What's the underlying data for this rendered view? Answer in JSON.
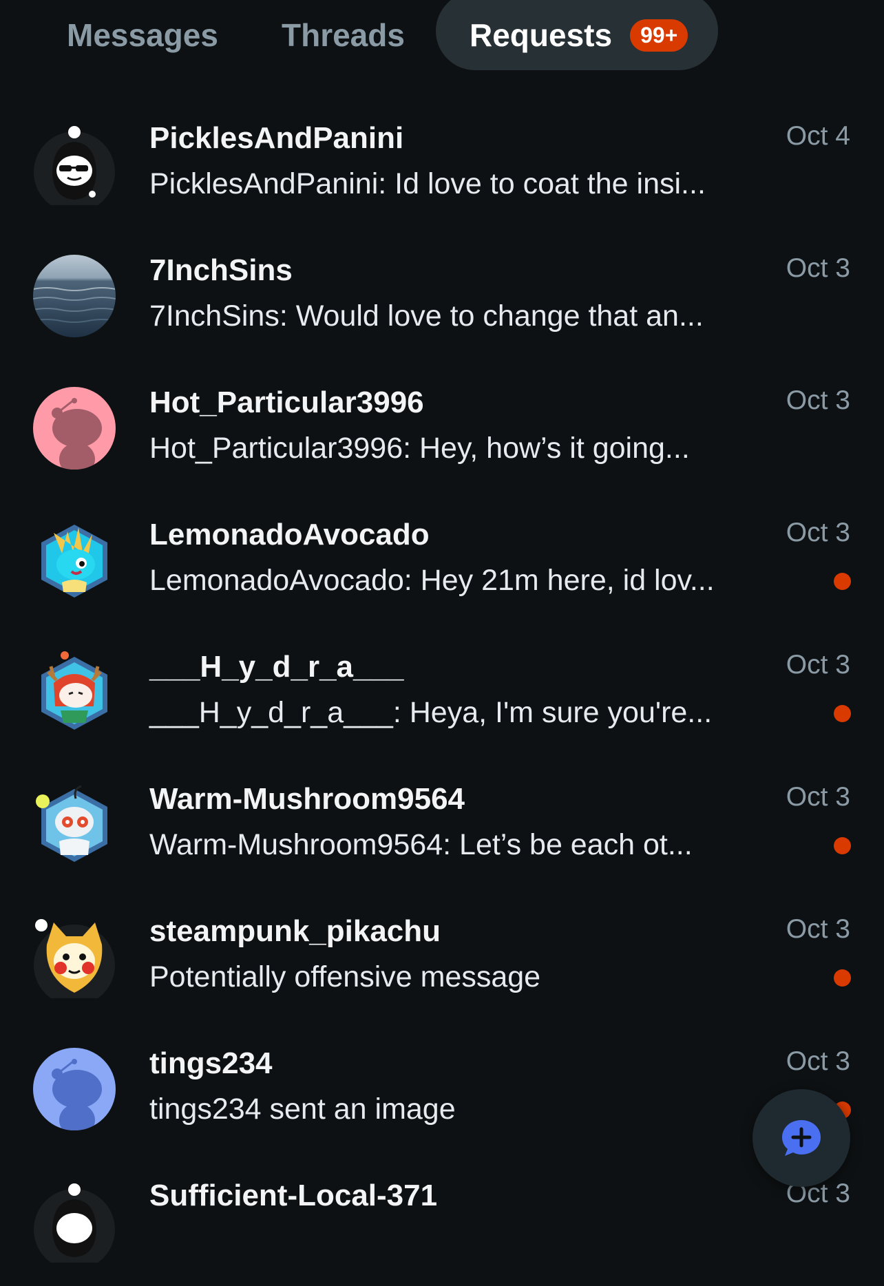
{
  "tabs": {
    "messages": "Messages",
    "threads": "Threads",
    "requests": "Requests",
    "requests_badge": "99+"
  },
  "requests": [
    {
      "name": "PicklesAndPanini",
      "preview": "PicklesAndPanini: Id love to coat the insi...",
      "date": "Oct 4",
      "unread": false,
      "avatar": "snoo-black-hood-sunglasses"
    },
    {
      "name": "7InchSins",
      "preview": "7InchSins: Would love to change that an...",
      "date": "Oct 3",
      "unread": false,
      "avatar": "ocean-photo"
    },
    {
      "name": "Hot_Particular3996",
      "preview": "Hot_Particular3996: Hey, how’s it going...",
      "date": "Oct 3",
      "unread": false,
      "avatar": "default-snoo-pink"
    },
    {
      "name": "LemonadoAvocado",
      "preview": "LemonadoAvocado: Hey 21m here, id lov...",
      "date": "Oct 3",
      "unread": true,
      "avatar": "nft-snoo-cyan-hexagon"
    },
    {
      "name": "___H_y_d_r_a___",
      "preview": "___H_y_d_r_a___: Heya, I'm sure you're...",
      "date": "Oct 3",
      "unread": true,
      "avatar": "nft-snoo-antlers-hexagon"
    },
    {
      "name": "Warm-Mushroom9564",
      "preview": "Warm-Mushroom9564: Let’s be each ot...",
      "date": "Oct 3",
      "unread": true,
      "avatar": "nft-snoo-robot-hexagon"
    },
    {
      "name": "steampunk_pikachu",
      "preview": "Potentially offensive message",
      "date": "Oct 3",
      "unread": true,
      "avatar": "snoo-yellow-costume"
    },
    {
      "name": "tings234",
      "preview": "tings234 sent an image",
      "date": "Oct 3",
      "unread": true,
      "avatar": "default-snoo-blue"
    },
    {
      "name": "Sufficient-Local-371",
      "preview": "",
      "date": "Oct 3",
      "unread": false,
      "avatar": "snoo-black-hood"
    }
  ],
  "colors": {
    "background": "#0e1113",
    "active_tab_bg": "#263035",
    "accent_orange": "#d93a00",
    "muted_text": "#8a9ba6",
    "fab_icon": "#4a6ff0"
  },
  "fab": {
    "icon": "new-chat-icon"
  }
}
